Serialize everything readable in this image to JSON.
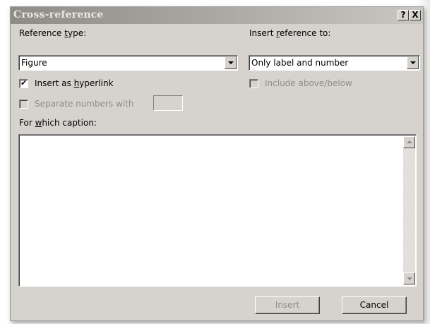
{
  "dialog": {
    "title": "Cross-reference",
    "help_label": "?",
    "close_label": "X"
  },
  "reference_type": {
    "label_pre": "Reference ",
    "label_accel": "t",
    "label_post": "ype:",
    "value": "Figure"
  },
  "insert_reference_to": {
    "label_pre": "Insert ",
    "label_accel": "r",
    "label_post": "eference to:",
    "value": "Only label and number"
  },
  "insert_as_hyperlink": {
    "label_pre": "Insert as ",
    "label_accel": "h",
    "label_post": "yperlink",
    "checked": true,
    "check_glyph": "✔"
  },
  "include_above_below": {
    "label": "Include above/below",
    "checked": false,
    "enabled": false
  },
  "separate_numbers": {
    "label": "Separate numbers with",
    "checked": false,
    "enabled": false,
    "value": ""
  },
  "for_which_caption": {
    "label_pre": "For ",
    "label_accel": "w",
    "label_post": "hich caption:",
    "items": []
  },
  "buttons": {
    "insert": "Insert",
    "cancel": "Cancel"
  }
}
